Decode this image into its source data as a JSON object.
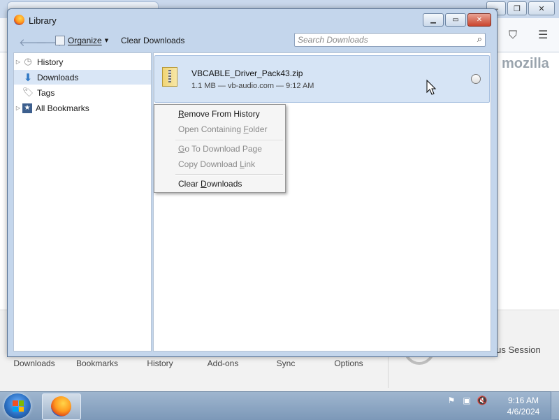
{
  "library": {
    "title": "Library",
    "toolbar": {
      "organize_label": "Organize",
      "clear_downloads_label": "Clear Downloads",
      "search_placeholder": "Search Downloads"
    },
    "sidebar": {
      "items": [
        {
          "label": "History",
          "icon": "clock-icon",
          "expandable": true,
          "selected": false
        },
        {
          "label": "Downloads",
          "icon": "download-arrow-icon",
          "expandable": false,
          "selected": true
        },
        {
          "label": "Tags",
          "icon": "tag-icon",
          "expandable": false,
          "selected": false
        },
        {
          "label": "All Bookmarks",
          "icon": "star-bookmark-icon",
          "expandable": true,
          "selected": false
        }
      ]
    },
    "download": {
      "filename": "VBCABLE_Driver_Pack43.zip",
      "meta": "1.1 MB — vb-audio.com — 9:12 AM"
    },
    "context_menu": {
      "items": [
        {
          "pre": "",
          "key": "R",
          "post": "emove From History",
          "enabled": true
        },
        {
          "pre": "Open Containing ",
          "key": "F",
          "post": "older",
          "enabled": false
        },
        {
          "pre": "",
          "key": "G",
          "post": "o To Download Page",
          "enabled": false
        },
        {
          "pre": "Copy Download ",
          "key": "L",
          "post": "ink",
          "enabled": false
        },
        {
          "pre": "Clear ",
          "key": "D",
          "post": "ownloads",
          "enabled": true
        }
      ]
    }
  },
  "background": {
    "brand": "mozilla",
    "launcher": [
      "Downloads",
      "Bookmarks",
      "History",
      "Add-ons",
      "Sync",
      "Options"
    ],
    "session_partial": "ious Session"
  },
  "taskbar": {
    "time": "9:16 AM",
    "date": "4/6/2024"
  },
  "colors": {
    "selection": "#d9e6f6",
    "close_button": "#c9452e",
    "taskbar": "#7c98b8"
  }
}
